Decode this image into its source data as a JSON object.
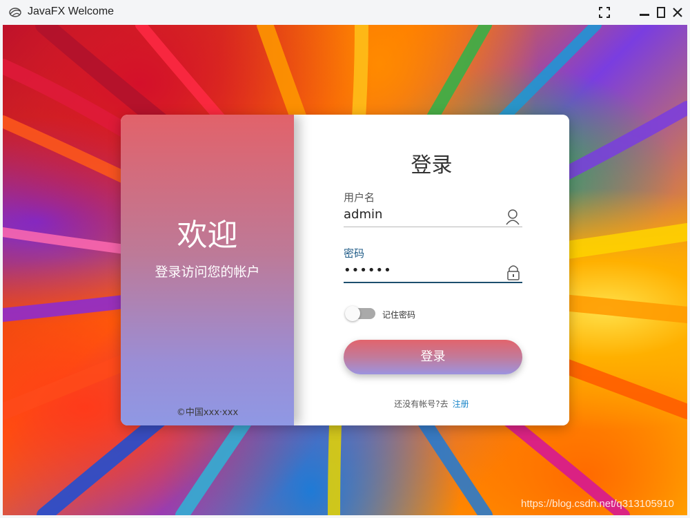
{
  "window": {
    "title": "JavaFX Welcome",
    "icons": [
      "app-icon",
      "fullscreen-icon",
      "minimize-icon",
      "maximize-icon",
      "close-icon"
    ]
  },
  "left_panel": {
    "title": "欢迎",
    "subtitle": "登录访问您的帐户",
    "copyright": "©中国xxx·xxx"
  },
  "login": {
    "title": "登录",
    "username_label": "用户名",
    "username_value": "admin",
    "password_label": "密码",
    "password_value": "••••••",
    "remember_label": "记住密码",
    "remember_checked": false,
    "submit_label": "登录",
    "register_prompt": "还没有帐号?去",
    "register_link": "注册"
  },
  "watermark": "https://blog.csdn.net/q313105910",
  "colors": {
    "gradient_top": "#e2626a",
    "gradient_bottom": "#8f98e4",
    "accent": "#1d5a86",
    "link": "#1a86c9"
  }
}
